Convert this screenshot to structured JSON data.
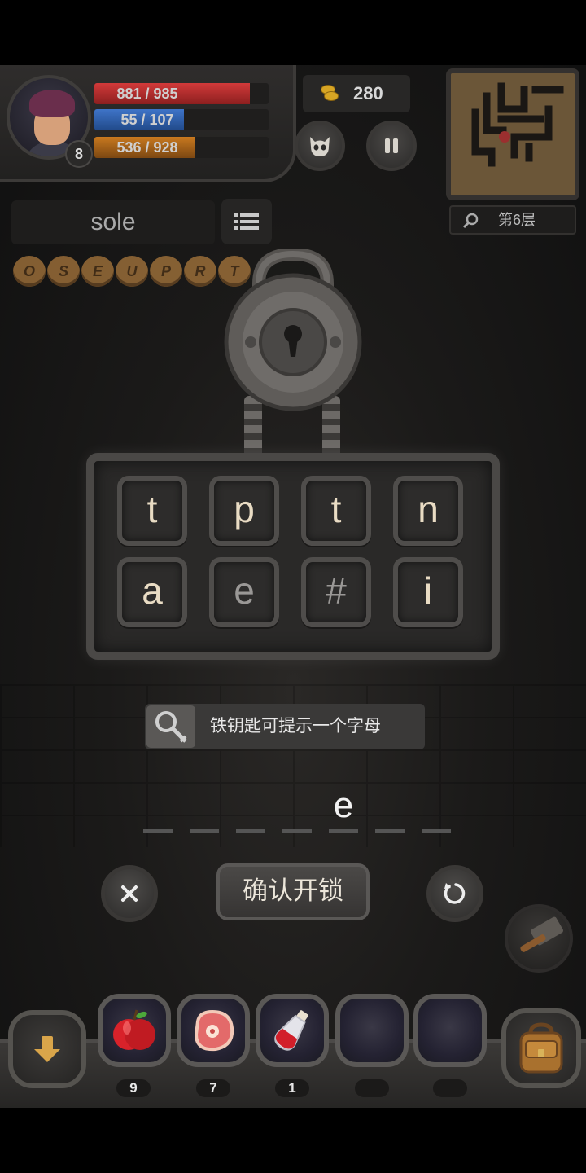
{
  "hero": {
    "level": "8",
    "hp": {
      "text": "881 / 985",
      "fraction": 0.894
    },
    "mp": {
      "text": "55 / 107",
      "fraction": 0.514
    },
    "xp": {
      "text": "536 / 928",
      "fraction": 0.578
    }
  },
  "gold": "280",
  "map": {
    "floor_label": "第6层"
  },
  "word_box": {
    "word": "sole"
  },
  "collected_letters": [
    "O",
    "S",
    "E",
    "U",
    "P",
    "R",
    "T"
  ],
  "lock_panel": {
    "keys": [
      {
        "char": "t",
        "state": "active"
      },
      {
        "char": "p",
        "state": "active"
      },
      {
        "char": "t",
        "state": "active"
      },
      {
        "char": "n",
        "state": "active"
      },
      {
        "char": "a",
        "state": "active"
      },
      {
        "char": "e",
        "state": "used"
      },
      {
        "char": "#",
        "state": "used"
      },
      {
        "char": "i",
        "state": "active"
      }
    ]
  },
  "hint": {
    "text": "铁钥匙可提示一个字母"
  },
  "answer_slots": [
    "",
    "",
    "",
    "",
    "e",
    "",
    ""
  ],
  "actions": {
    "confirm_label": "确认开锁"
  },
  "inventory": [
    {
      "item": "apple",
      "count": "9"
    },
    {
      "item": "meat",
      "count": "7"
    },
    {
      "item": "red-potion",
      "count": "1"
    },
    {
      "item": "empty",
      "count": ""
    },
    {
      "item": "empty",
      "count": ""
    }
  ],
  "colors": {
    "hp": "#d23a3a",
    "mp": "#3f74c8",
    "xp": "#c8791f",
    "key_text": "#e9dcc4",
    "gold": "#d7a524"
  }
}
